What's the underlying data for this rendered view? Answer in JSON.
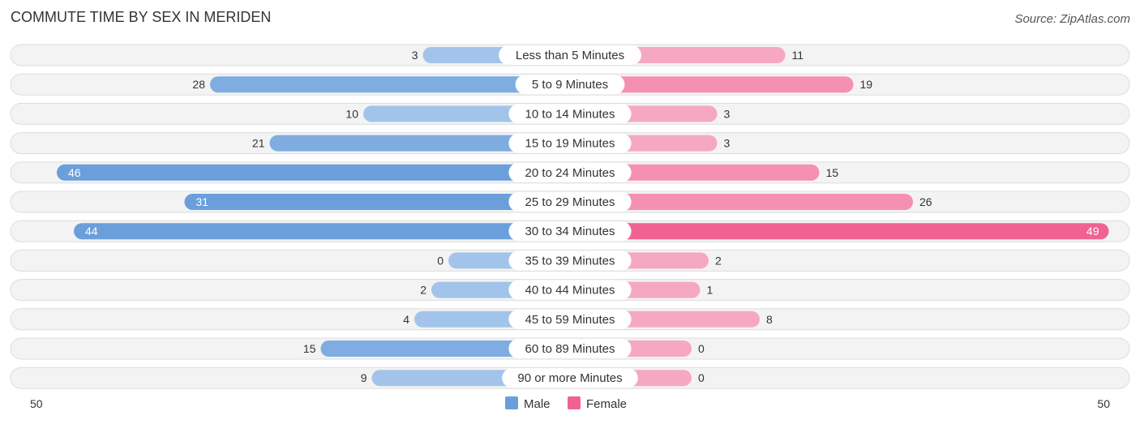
{
  "title": "COMMUTE TIME BY SEX IN MERIDEN",
  "source": "Source: ZipAtlas.com",
  "chart_data": {
    "type": "bar",
    "orientation": "horizontal-diverging",
    "title": "COMMUTE TIME BY SEX IN MERIDEN",
    "categories": [
      "Less than 5 Minutes",
      "5 to 9 Minutes",
      "10 to 14 Minutes",
      "15 to 19 Minutes",
      "20 to 24 Minutes",
      "25 to 29 Minutes",
      "30 to 34 Minutes",
      "35 to 39 Minutes",
      "40 to 44 Minutes",
      "45 to 59 Minutes",
      "60 to 89 Minutes",
      "90 or more Minutes"
    ],
    "series": [
      {
        "name": "Male",
        "color": "#6a9fdc",
        "values": [
          3,
          28,
          10,
          21,
          46,
          31,
          44,
          0,
          2,
          4,
          15,
          9
        ]
      },
      {
        "name": "Female",
        "color": "#f06292",
        "values": [
          11,
          19,
          3,
          3,
          15,
          26,
          49,
          2,
          1,
          8,
          0,
          0
        ]
      }
    ],
    "axis_min_label": "50",
    "axis_max_label": "50",
    "xlim": [
      50,
      50
    ],
    "legend": "bottom-center"
  }
}
